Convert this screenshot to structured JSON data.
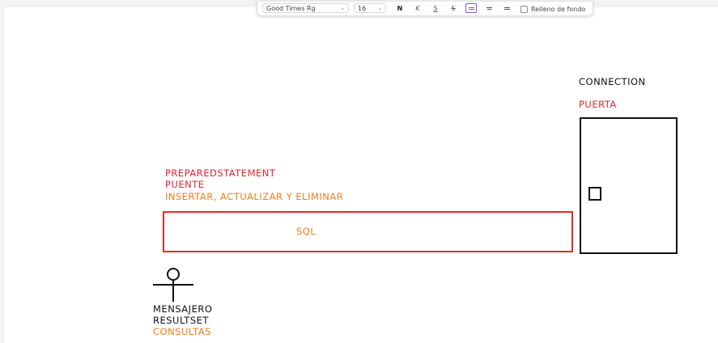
{
  "toolbar": {
    "font_family_value": "Good Times Rg",
    "font_size_value": "16",
    "bold_label": "N",
    "italic_label": "K",
    "underline_label": "S",
    "strikethrough_label": "S",
    "background_label": "Relleno de fondo",
    "background_checked": false
  },
  "drawing": {
    "connection_label": "CONNECTION",
    "door_label": "PUERTA",
    "prepared_statement_label": "PREPAREDSTATEMENT",
    "bridge_label": "PUENTE",
    "operations_label": "INSERTAR, ACTUALIZAR Y ELIMINAR",
    "sql_label": "SQL",
    "messenger_label": "MENSAJERO",
    "resultset_label": "RESULTSET",
    "queries_label": "CONSULTAS"
  },
  "colors": {
    "black": "#111111",
    "red": "#e0262e",
    "orange": "#f47c1c",
    "accent": "#7e5bd6"
  }
}
